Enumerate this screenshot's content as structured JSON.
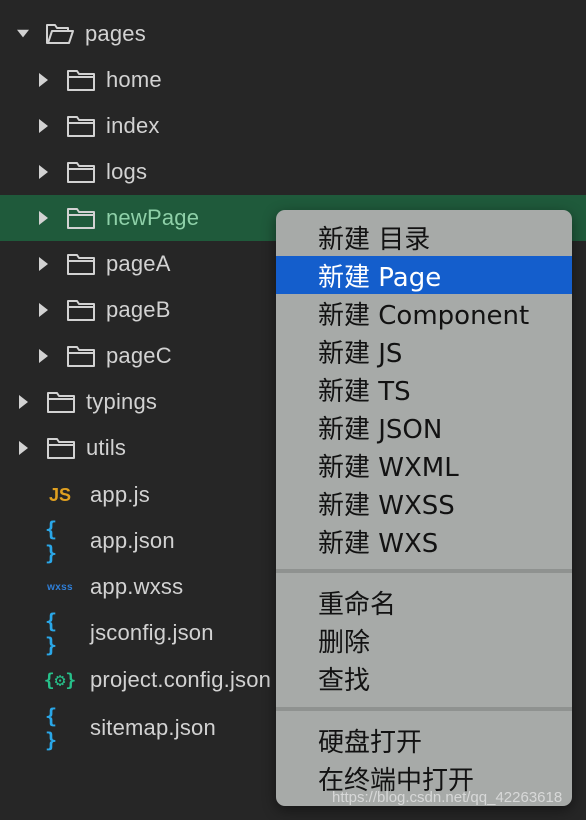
{
  "tree": [
    {
      "label": "pages",
      "type": "folder-open",
      "expanded": true,
      "depth": 0
    },
    {
      "label": "home",
      "type": "folder",
      "depth": 1
    },
    {
      "label": "index",
      "type": "folder",
      "depth": 1
    },
    {
      "label": "logs",
      "type": "folder",
      "depth": 1
    },
    {
      "label": "newPage",
      "type": "folder",
      "depth": 1,
      "selected": true
    },
    {
      "label": "pageA",
      "type": "folder",
      "depth": 1
    },
    {
      "label": "pageB",
      "type": "folder",
      "depth": 1
    },
    {
      "label": "pageC",
      "type": "folder",
      "depth": 1
    },
    {
      "label": "typings",
      "type": "folder",
      "depth": 0
    },
    {
      "label": "utils",
      "type": "folder",
      "depth": 0
    },
    {
      "label": "app.js",
      "type": "js",
      "icon": "JS"
    },
    {
      "label": "app.json",
      "type": "json",
      "icon": "{ }"
    },
    {
      "label": "app.wxss",
      "type": "wxss",
      "icon": "wxss"
    },
    {
      "label": "jsconfig.json",
      "type": "json",
      "icon": "{ }"
    },
    {
      "label": "project.config.json",
      "type": "config",
      "icon": "{⚙}"
    },
    {
      "label": "sitemap.json",
      "type": "json",
      "icon": "{ }"
    }
  ],
  "context_menu": {
    "items": [
      {
        "label": "新建 目录"
      },
      {
        "label": "新建 Page",
        "active": true
      },
      {
        "label": "新建 Component"
      },
      {
        "label": "新建 JS"
      },
      {
        "label": "新建 TS"
      },
      {
        "label": "新建 JSON"
      },
      {
        "label": "新建 WXML"
      },
      {
        "label": "新建 WXSS"
      },
      {
        "label": "新建 WXS"
      },
      {
        "label": "重命名"
      },
      {
        "label": "删除"
      },
      {
        "label": "查找"
      },
      {
        "label": "硬盘打开"
      },
      {
        "label": "在终端中打开"
      }
    ]
  },
  "watermark": "https://blog.csdn.net/qq_42263618",
  "colors": {
    "background": "#262626",
    "selected_row": "#1f5a3b",
    "menu_bg": "#a7aaa8",
    "menu_highlight": "#145ecc",
    "js_icon": "#e0a020",
    "json_icon": "#2aa7e8",
    "wxss_icon": "#2f7fd8",
    "config_icon": "#27c08a"
  }
}
